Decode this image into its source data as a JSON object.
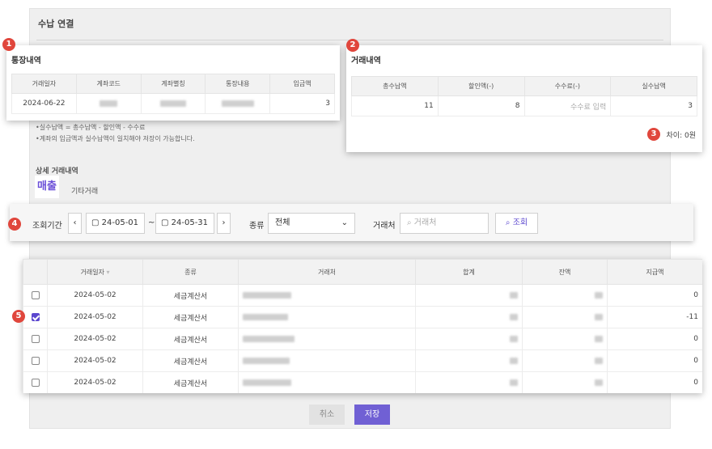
{
  "page": {
    "title": "수납 연결",
    "notes": [
      "•실수납액 = 총수납액 - 할인액 - 수수료",
      "•계좌의 입금액과 실수납액이 일치해야 저장이 가능합니다."
    ],
    "section_label": "상세 거래내역",
    "tabs": {
      "active": "매출",
      "other": "기타거래"
    },
    "cancel_label": "취소",
    "save_label": "저장"
  },
  "badges": [
    "1",
    "2",
    "3",
    "4",
    "5"
  ],
  "bank": {
    "title": "통장내역",
    "columns": [
      "거래일자",
      "계좌코드",
      "계좌별칭",
      "통장내용",
      "입금액"
    ],
    "row": {
      "date": "2024-06-22",
      "amount": "3"
    }
  },
  "txn": {
    "title": "거래내역",
    "columns": [
      "총수납액",
      "할인액(-)",
      "수수료(-)",
      "실수납액"
    ],
    "row": {
      "total": "11",
      "discount": "8",
      "fee_placeholder": "수수료 입력",
      "actual": "3"
    },
    "diff": "차이: 0원"
  },
  "filter": {
    "period_label": "조회기간",
    "prev_icon": "chevron-left-icon",
    "next_icon": "chevron-right-icon",
    "start": "24-05-01",
    "tilde": "~",
    "end": "24-05-31",
    "type_label": "종류",
    "type_value": "전체",
    "partner_label": "거래처",
    "partner_placeholder": "거래처",
    "search_label": "조회"
  },
  "grid": {
    "columns": [
      "거래일자",
      "종류",
      "거래처",
      "합계",
      "잔액",
      "지급액"
    ],
    "rows": [
      {
        "checked": false,
        "date": "2024-05-02",
        "type": "세금계산서",
        "paid": "0"
      },
      {
        "checked": true,
        "date": "2024-05-02",
        "type": "세금계산서",
        "paid": "-11"
      },
      {
        "checked": false,
        "date": "2024-05-02",
        "type": "세금계산서",
        "paid": "0"
      },
      {
        "checked": false,
        "date": "2024-05-02",
        "type": "세금계산서",
        "paid": "0"
      },
      {
        "checked": false,
        "date": "2024-05-02",
        "type": "세금계산서",
        "paid": "0"
      }
    ]
  },
  "colors": {
    "accent": "#6b4fd8",
    "badge": "#e0463c",
    "save": "#7060d4"
  }
}
